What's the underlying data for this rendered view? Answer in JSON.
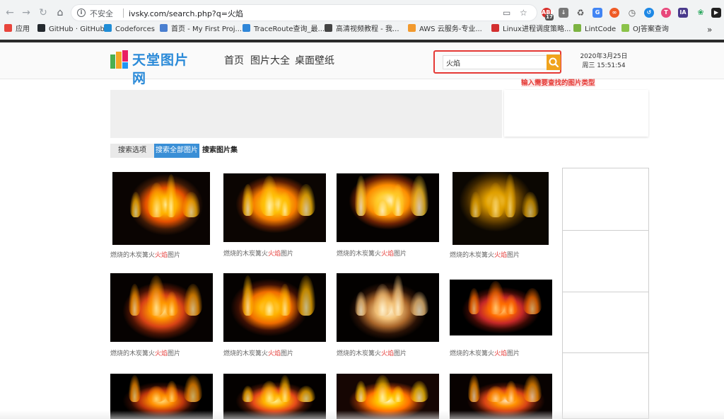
{
  "browser": {
    "security_label": "不安全",
    "url": "ivsky.com/search.php?q=火焰",
    "bookmarks": [
      {
        "label": "应用",
        "color": "#e8453c"
      },
      {
        "label": "GitHub · GitHub",
        "color": "#24292e"
      },
      {
        "label": "Codeforces",
        "color": "#1f8dd6"
      },
      {
        "label": "首页 - My First Proj...",
        "color": "#4a7fd0"
      },
      {
        "label": "TraceRoute查询_最...",
        "color": "#2f86d8"
      },
      {
        "label": "高清视频教程 - 我...",
        "color": "#444444"
      },
      {
        "label": "AWS 云服务-专业...",
        "color": "#f29a2e"
      },
      {
        "label": "Linux进程调度策略...",
        "color": "#d32f2f"
      },
      {
        "label": "LintCode",
        "color": "#7cb342"
      },
      {
        "label": "OJ答案查询",
        "color": "#8bc34a"
      }
    ],
    "bookmarks_more": "»",
    "extension_badge": "17"
  },
  "site": {
    "logo_text": "天堂图片网",
    "nav": [
      "首页",
      "图片大全",
      "桌面壁纸"
    ],
    "search_value": "火焰",
    "date_line1": "2020年3月25日",
    "date_line2": "周三 15:51:54",
    "annotation": "输入需要查找的图片类型"
  },
  "tabs": {
    "options": "搜索选项",
    "all": "搜索全部图片",
    "sets": "搜索图片集"
  },
  "captions": {
    "prefix": "燃烧的木炭篝火",
    "highlight": "火焰",
    "suffix": "图片"
  },
  "images": [
    {
      "name": "image-1",
      "theme": "charred-log"
    },
    {
      "name": "image-2",
      "theme": "bright-bonfire"
    },
    {
      "name": "image-3",
      "theme": "tall-flames"
    },
    {
      "name": "image-4",
      "theme": "smoky-fire"
    },
    {
      "name": "image-5",
      "theme": "ember-sticks"
    },
    {
      "name": "image-6",
      "theme": "log-fire"
    },
    {
      "name": "image-7",
      "theme": "distant-pile"
    },
    {
      "name": "image-8",
      "theme": "glowing-logs"
    },
    {
      "name": "image-9",
      "theme": "night-fire"
    },
    {
      "name": "image-10",
      "theme": "burning-wood"
    },
    {
      "name": "image-11",
      "theme": "orange-blaze"
    },
    {
      "name": "image-12",
      "theme": "coal-bed"
    }
  ],
  "colors": {
    "accent_blue": "#3a8fd6",
    "highlight_red": "#e53935",
    "search_button": "#f0a31d"
  }
}
